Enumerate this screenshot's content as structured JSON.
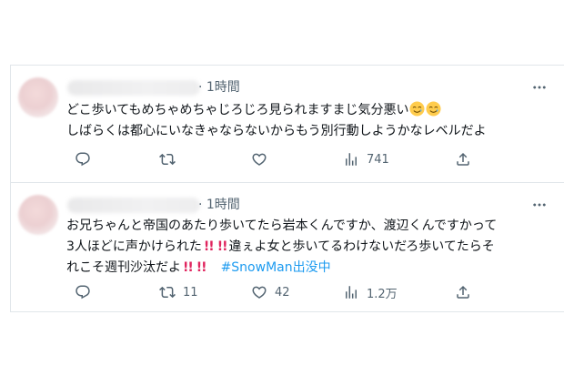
{
  "tweets": [
    {
      "time": "· 1時間",
      "lines": [
        "どこ歩いてもめちゃめちゃじろじろ見られますまじ気分悪い",
        "しばらくは都心にいなきゃならないからもう別行動しようかなレベルだよ"
      ],
      "emojis": [
        "smiling-face-with-tear",
        "smiling-face-with-tear"
      ],
      "replies": "",
      "retweets": "",
      "likes": "",
      "views": "741"
    },
    {
      "time": "· 1時間",
      "lines": [
        "お兄ちゃんと帝国のあたり歩いてたら岩本くんですか、渡辺くんですかって",
        "3人ほどに声かけられた",
        "違ぇよ女と歩いてるわけないだろ歩いてたらそ",
        "れこそ週刊沙汰だよ"
      ],
      "bang": "!!",
      "hashtag": "#SnowMan出没中",
      "replies": "",
      "retweets": "11",
      "likes": "42",
      "views": "1.2万"
    }
  ],
  "icons": {
    "more": "more-dots-icon",
    "reply": "reply-icon",
    "retweet": "retweet-icon",
    "like": "heart-icon",
    "views": "views-bar-chart-icon",
    "share": "share-upload-icon"
  },
  "colors": {
    "text": "#0f1419",
    "secondary": "#536471",
    "hashtag": "#1d9bf0",
    "exclamation": "#e0245e",
    "border": "#e1e6ea"
  }
}
